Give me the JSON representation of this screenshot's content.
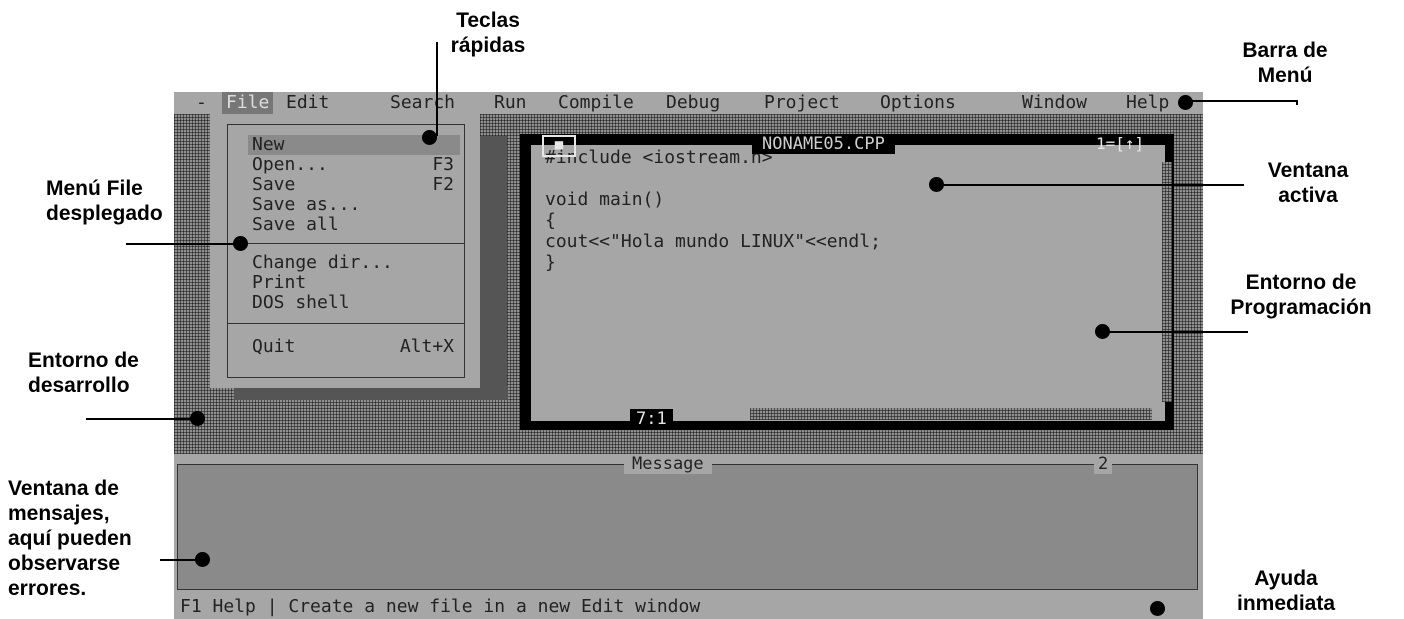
{
  "menubar": {
    "system": "-",
    "items": [
      "File",
      "Edit",
      "Search",
      "Run",
      "Compile",
      "Debug",
      "Project",
      "Options",
      "Window",
      "Help"
    ]
  },
  "file_menu": {
    "items": [
      {
        "label": "New",
        "key": ""
      },
      {
        "label": "Open...",
        "key": "F3"
      },
      {
        "label": "Save",
        "key": "F2"
      },
      {
        "label": "Save as...",
        "key": ""
      },
      {
        "label": "Save all",
        "key": ""
      },
      {
        "label": "Change dir...",
        "key": ""
      },
      {
        "label": "Print",
        "key": ""
      },
      {
        "label": "DOS shell",
        "key": ""
      },
      {
        "label": "Quit",
        "key": "Alt+X"
      }
    ]
  },
  "editor": {
    "close_glyph": "■",
    "title": "NONAME05.CPP",
    "window_number": "1=[↑]",
    "code_lines": [
      "#include <iostream.h>",
      "",
      "void main()",
      "{",
      "cout<<\"Hola mundo LINUX\"<<endl;",
      "}"
    ],
    "cursor_position": "7:1"
  },
  "message_window": {
    "title": "Message",
    "number": "2"
  },
  "status_bar": {
    "text": "F1 Help | Create a new file in a new Edit window"
  },
  "annotations": {
    "teclas_rapidas": "Teclas\nrápidas",
    "barra_menu": "Barra de\nMenú",
    "menu_file": "Menú  File\ndesplegado",
    "ventana_activa": "Ventana\nactiva",
    "entorno_programacion": "Entorno de\nProgramación",
    "entorno_desarrollo": "Entorno de\ndesarrollo",
    "ventana_mensajes": "Ventana de\nmensajes,\naquí pueden\nobservarse\nerrores.",
    "ayuda_inmediata": "Ayuda\ninmediata"
  }
}
